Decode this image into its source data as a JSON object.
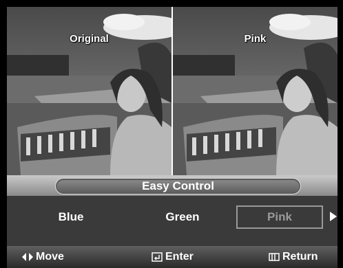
{
  "preview": {
    "left_label": "Original",
    "right_label": "Pink"
  },
  "menu": {
    "title": "Easy Control",
    "options": [
      "Blue",
      "Green",
      "Pink"
    ],
    "selected": "Pink"
  },
  "help": {
    "move": "Move",
    "enter": "Enter",
    "return": "Return"
  },
  "colors": {
    "panel_bg": "#3a3a3a",
    "selection_border": "#9a9a9a"
  },
  "icons": [
    "move-arrows-icon",
    "enter-icon",
    "return-menu-icon",
    "scroll-right-arrow-icon"
  ]
}
